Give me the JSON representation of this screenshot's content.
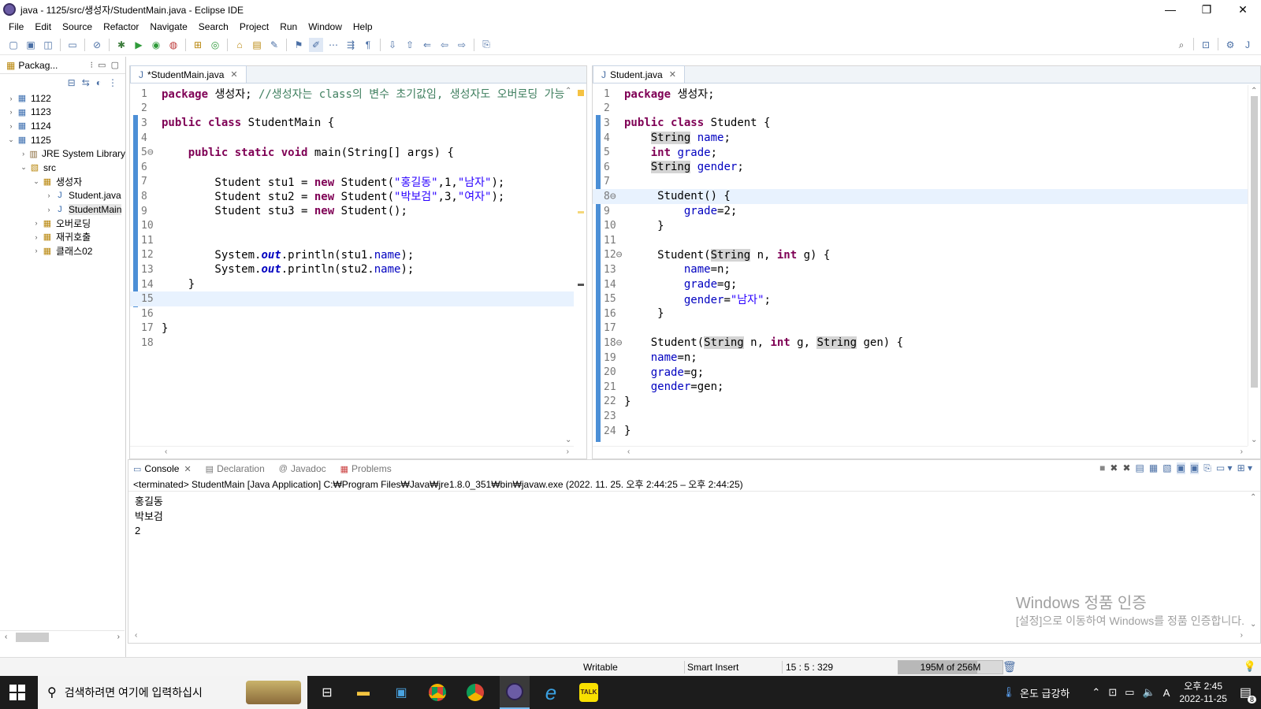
{
  "window": {
    "title": "java - 1125/src/생성자/StudentMain.java - Eclipse IDE",
    "controls": [
      "—",
      "❐",
      "✕"
    ]
  },
  "menu": [
    "File",
    "Edit",
    "Source",
    "Refactor",
    "Navigate",
    "Search",
    "Project",
    "Run",
    "Window",
    "Help"
  ],
  "package_explorer": {
    "title": "Packag...",
    "items": [
      {
        "label": "1122",
        "level": 0,
        "arrow": "›",
        "icon": "project-icon"
      },
      {
        "label": "1123",
        "level": 0,
        "arrow": "›",
        "icon": "project-icon"
      },
      {
        "label": "1124",
        "level": 0,
        "arrow": "›",
        "icon": "project-icon"
      },
      {
        "label": "1125",
        "level": 0,
        "arrow": "⌄",
        "icon": "project-icon"
      },
      {
        "label": "JRE System Library",
        "level": 1,
        "arrow": "›",
        "icon": "library-icon"
      },
      {
        "label": "src",
        "level": 1,
        "arrow": "⌄",
        "icon": "src-folder-icon"
      },
      {
        "label": "생성자",
        "level": 2,
        "arrow": "⌄",
        "icon": "package-icon"
      },
      {
        "label": "Student.java",
        "level": 3,
        "arrow": "›",
        "icon": "java-file-icon"
      },
      {
        "label": "StudentMain",
        "level": 3,
        "arrow": "›",
        "icon": "java-file-icon",
        "selected": true
      },
      {
        "label": "오버로딩",
        "level": 2,
        "arrow": "›",
        "icon": "package-icon"
      },
      {
        "label": "재귀호출",
        "level": 2,
        "arrow": "›",
        "icon": "package-icon"
      },
      {
        "label": "클래스02",
        "level": 2,
        "arrow": "›",
        "icon": "package-icon"
      }
    ]
  },
  "editor_left": {
    "tab": "*StudentMain.java",
    "current_line": 15,
    "lines": [
      "<span class=\"kw\">package</span> 생성자; <span class=\"cmt\">//생성자는 class의 변수 초기값임, 생성자도 오버로딩 가능</span>",
      "",
      "<span class=\"kw\">public</span> <span class=\"kw\">class</span> StudentMain {",
      "",
      "    <span class=\"kw\">public</span> <span class=\"kw\">static</span> <span class=\"kw\">void</span> main(String[] args) {",
      "",
      "        Student stu1 = <span class=\"kw\">new</span> Student(<span class=\"str\">\"홍길동\"</span>,1,<span class=\"str\">\"남자\"</span>);",
      "        Student stu2 = <span class=\"kw\">new</span> Student(<span class=\"str\">\"박보검\"</span>,3,<span class=\"str\">\"여자\"</span>);",
      "        Student stu3 = <span class=\"kw\">new</span> Student();",
      "",
      "",
      "        System.<span class=\"stat\">out</span>.println(stu1.<span class=\"fld\">name</span>);",
      "        System.<span class=\"stat\">out</span>.println(stu2.<span class=\"fld\">name</span>);",
      "    }",
      "",
      "",
      "}",
      ""
    ]
  },
  "editor_right": {
    "tab": "Student.java",
    "current_line": 8,
    "lines": [
      "<span class=\"kw\">package</span> 생성자;",
      "",
      "<span class=\"kw\">public</span> <span class=\"kw\">class</span> Student {",
      "    <span class=\"hl\">String</span> <span class=\"fld\">name</span>;",
      "    <span class=\"kw\">int</span> <span class=\"fld\">grade</span>;",
      "    <span class=\"hl\">String</span> <span class=\"fld\">gender</span>;",
      "",
      "     Student() {",
      "         <span class=\"fld\">grade</span>=2;",
      "     }",
      "",
      "     Student(<span class=\"hl\">String</span> n, <span class=\"kw\">int</span> g) {",
      "         <span class=\"fld\">name</span>=n;",
      "         <span class=\"fld\">grade</span>=g;",
      "         <span class=\"fld\">gender</span>=<span class=\"str\">\"남자\"</span>;",
      "     }",
      "",
      "    Student(<span class=\"hl\">String</span> n, <span class=\"kw\">int</span> g, <span class=\"hl\">String</span> gen) {",
      "    <span class=\"fld\">name</span>=n;",
      "    <span class=\"fld\">grade</span>=g;",
      "    <span class=\"fld\">gender</span>=gen;",
      "}",
      "",
      "}"
    ]
  },
  "console": {
    "tabs": [
      "Console",
      "Declaration",
      "Javadoc",
      "Problems"
    ],
    "description": "<terminated> StudentMain [Java Application] C:₩Program Files₩Java₩jre1.8.0_351₩bin₩javaw.exe  (2022. 11. 25. 오후 2:44:25 – 오후 2:44:25)",
    "output": [
      "홍길동",
      "박보검",
      "2"
    ]
  },
  "watermark": {
    "line1": "Windows 정품 인증",
    "line2": "[설정]으로 이동하여 Windows를 정품 인증합니다."
  },
  "statusbar": {
    "mode": "Writable",
    "insert": "Smart Insert",
    "position": "15 : 5 : 329",
    "heap": "195M of 256M",
    "heap_used_fraction": 0.76
  },
  "taskbar": {
    "search_placeholder": "검색하려면 여기에 입력하십시",
    "weather": "온도 급강하",
    "time": "오후 2:45",
    "date": "2022-11-25",
    "notification_count": "8"
  },
  "colors": {
    "keyword": "#7f0055",
    "string": "#2a00ff",
    "comment": "#3f7f5f",
    "field": "#0000c0",
    "current_line": "#e8f2fe"
  }
}
